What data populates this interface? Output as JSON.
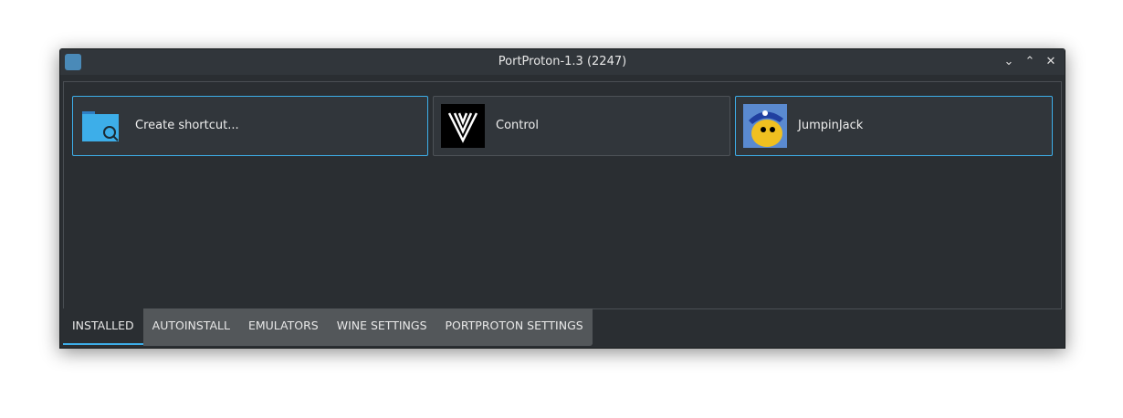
{
  "window": {
    "title": "PortProton-1.3 (2247)",
    "controls": [
      "minimize",
      "maximize",
      "close"
    ]
  },
  "cards": [
    {
      "label": "Create shortcut...",
      "icon": "folder-search-icon",
      "selected": true
    },
    {
      "label": "Control",
      "icon": "control-game-icon",
      "selected": false
    },
    {
      "label": "JumpinJack",
      "icon": "jumpinjack-game-icon",
      "selected": true
    }
  ],
  "tabs": [
    {
      "label": "INSTALLED",
      "active": true
    },
    {
      "label": "AUTOINSTALL"
    },
    {
      "label": "EMULATORS"
    },
    {
      "label": "WINE SETTINGS"
    },
    {
      "label": "PORTPROTON SETTINGS"
    }
  ],
  "colors": {
    "accent": "#3daee9",
    "bg": "#2a2e32"
  }
}
